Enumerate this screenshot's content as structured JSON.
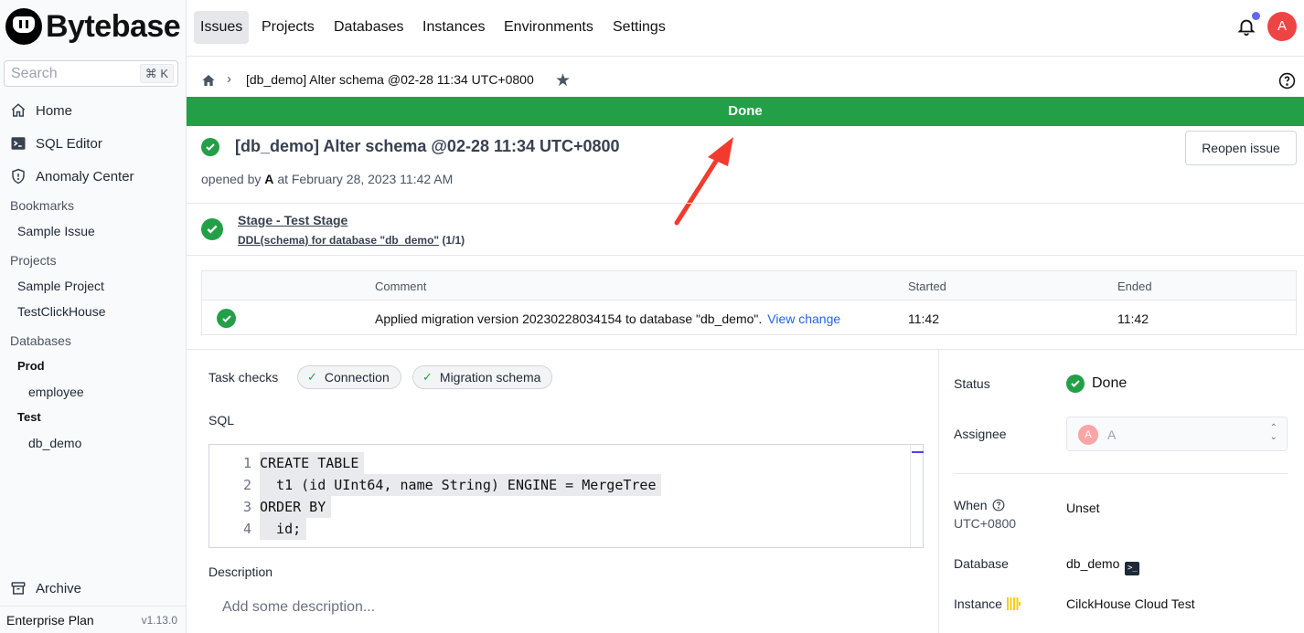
{
  "brand": {
    "name": "Bytebase"
  },
  "search": {
    "placeholder": "Search",
    "shortcut": "⌘ K"
  },
  "sidebar": {
    "main_items": [
      {
        "label": "Home",
        "icon": "home-icon"
      },
      {
        "label": "SQL Editor",
        "icon": "terminal-icon"
      },
      {
        "label": "Anomaly Center",
        "icon": "shield-icon"
      }
    ],
    "bookmarks": {
      "title": "Bookmarks",
      "items": [
        "Sample Issue"
      ]
    },
    "projects": {
      "title": "Projects",
      "items": [
        "Sample Project",
        "TestClickHouse"
      ]
    },
    "databases": {
      "title": "Databases",
      "envs": [
        {
          "name": "Prod",
          "dbs": [
            "employee"
          ]
        },
        {
          "name": "Test",
          "dbs": [
            "db_demo"
          ]
        }
      ]
    },
    "archive": "Archive",
    "plan": "Enterprise Plan",
    "version": "v1.13.0"
  },
  "topnav": {
    "items": [
      "Issues",
      "Projects",
      "Databases",
      "Instances",
      "Environments",
      "Settings"
    ],
    "active": "Issues",
    "avatar_initial": "A"
  },
  "breadcrumb": {
    "title": "[db_demo] Alter schema @02-28 11:34 UTC+0800"
  },
  "banner": {
    "text": "Done",
    "color": "#23a047"
  },
  "issue": {
    "title": "[db_demo] Alter schema @02-28 11:34 UTC+0800",
    "opened_prefix": "opened by",
    "opened_by": "A",
    "opened_suffix": "at February 28, 2023 11:42 AM",
    "reopen_label": "Reopen issue"
  },
  "stage": {
    "name": "Stage - Test Stage",
    "task": "DDL(schema) for database \"db_demo\"",
    "count": "(1/1)"
  },
  "task_run": {
    "headers": [
      "Comment",
      "Started",
      "Ended"
    ],
    "row": {
      "comment": "Applied migration version 20230228034154 to database \"db_demo\".",
      "link": "View change",
      "started": "11:42",
      "ended": "11:42"
    }
  },
  "task_checks": {
    "label": "Task checks",
    "items": [
      "Connection",
      "Migration schema"
    ]
  },
  "sql": {
    "label": "SQL",
    "lines": [
      {
        "n": "1",
        "parts": [
          {
            "t": "CREATE TABLE",
            "kw": true
          }
        ]
      },
      {
        "n": "2",
        "parts": [
          {
            "t": "  t1 (id UInt64, name String) ENGINE = MergeTree",
            "kw": false
          }
        ]
      },
      {
        "n": "3",
        "parts": [
          {
            "t": "ORDER BY",
            "kw": true
          }
        ]
      },
      {
        "n": "4",
        "parts": [
          {
            "t": "  id;",
            "kw": false
          }
        ]
      }
    ]
  },
  "description": {
    "label": "Description",
    "placeholder": "Add some description..."
  },
  "details": {
    "status_label": "Status",
    "status_value": "Done",
    "assignee_label": "Assignee",
    "assignee_initial": "A",
    "assignee_name": "A",
    "when_label": "When",
    "when_tz": "UTC+0800",
    "when_value": "Unset",
    "database_label": "Database",
    "database_value": "db_demo",
    "instance_label": "Instance",
    "instance_value": "CilckHouse Cloud Test"
  }
}
